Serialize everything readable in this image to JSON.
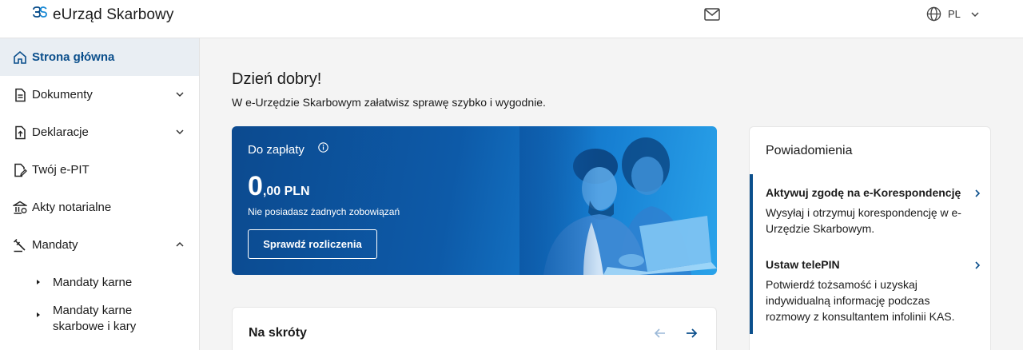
{
  "header": {
    "logo_text": "eUrząd Skarbowy",
    "mail_icon": "mail-icon",
    "language": "PL"
  },
  "sidebar": {
    "items": [
      {
        "label": "Strona główna",
        "icon": "home-icon",
        "active": true
      },
      {
        "label": "Dokumenty",
        "icon": "document-icon",
        "expandable": true
      },
      {
        "label": "Deklaracje",
        "icon": "declaration-upload-icon",
        "expandable": true
      },
      {
        "label": "Twój e-PIT",
        "icon": "epit-icon"
      },
      {
        "label": "Akty notarialne",
        "icon": "notary-icon"
      },
      {
        "label": "Mandaty",
        "icon": "mandate-icon",
        "expanded": true
      }
    ],
    "subitems": [
      {
        "label": "Mandaty karne"
      },
      {
        "label": "Mandaty karne skarbowe i kary"
      }
    ]
  },
  "main": {
    "greeting": "Dzień dobry!",
    "greeting_sub": "W e-Urzędzie Skarbowym załatwisz sprawę szybko i wygodnie.",
    "payment": {
      "title": "Do zapłaty",
      "amount_int": "0",
      "amount_rest": ",00 PLN",
      "note": "Nie posiadasz żadnych zobowiązań",
      "button": "Sprawdź rozliczenia"
    },
    "shortcuts": {
      "title": "Na skróty"
    }
  },
  "notifications": {
    "title": "Powiadomienia",
    "items": [
      {
        "title": "Aktywuj zgodę na e-Korespondencję",
        "body": "Wysyłaj i otrzymuj korespondencję w e-Urzędzie Skarbowym."
      },
      {
        "title": "Ustaw telePIN",
        "body": "Potwierdź tożsamość i uzyskaj indywidualną informację podczas rozmowy z konsultantem infolinii KAS."
      }
    ]
  },
  "colors": {
    "primary": "#0b4f8c",
    "card_gradient_start": "#0c4a8f",
    "card_gradient_end": "#2aa3ea",
    "active_nav_bg": "#e9eef3"
  }
}
